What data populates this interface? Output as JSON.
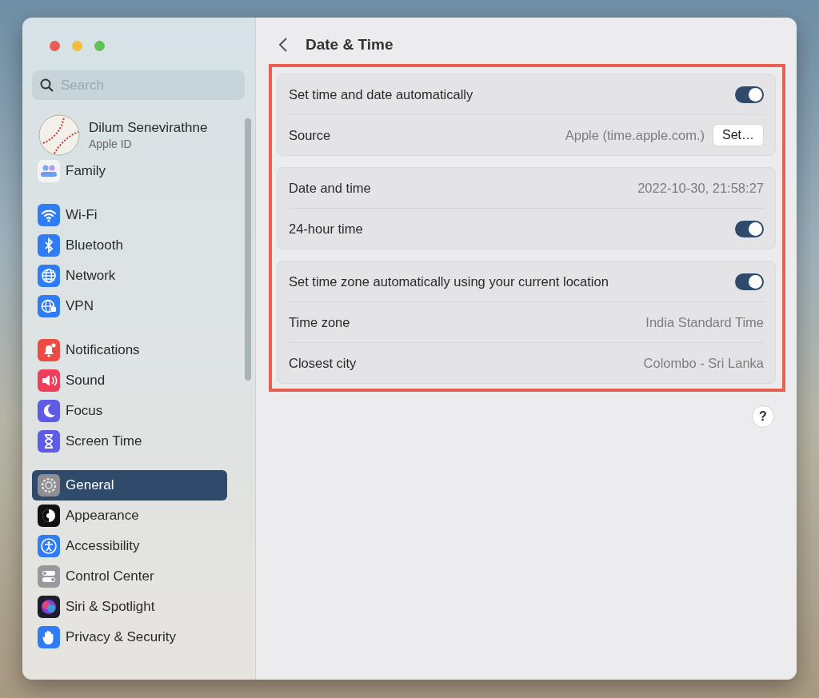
{
  "sidebar": {
    "search": {
      "placeholder": "Search"
    },
    "profile": {
      "name": "Dilum Senevirathne",
      "subtitle": "Apple ID"
    },
    "groups": [
      {
        "items": [
          {
            "label": "Family",
            "kind": "family",
            "selected": false
          }
        ]
      },
      {
        "items": [
          {
            "label": "Wi-Fi",
            "kind": "wifi",
            "selected": false
          },
          {
            "label": "Bluetooth",
            "kind": "bluetooth",
            "selected": false
          },
          {
            "label": "Network",
            "kind": "network",
            "selected": false
          },
          {
            "label": "VPN",
            "kind": "vpn",
            "selected": false
          }
        ]
      },
      {
        "items": [
          {
            "label": "Notifications",
            "kind": "notifications",
            "selected": false
          },
          {
            "label": "Sound",
            "kind": "sound",
            "selected": false
          },
          {
            "label": "Focus",
            "kind": "focus",
            "selected": false
          },
          {
            "label": "Screen Time",
            "kind": "screentime",
            "selected": false
          }
        ]
      },
      {
        "items": [
          {
            "label": "General",
            "kind": "general",
            "selected": true
          },
          {
            "label": "Appearance",
            "kind": "appearance",
            "selected": false
          },
          {
            "label": "Accessibility",
            "kind": "accessibility",
            "selected": false
          },
          {
            "label": "Control Center",
            "kind": "controlcenter",
            "selected": false
          },
          {
            "label": "Siri & Spotlight",
            "kind": "siri",
            "selected": false
          },
          {
            "label": "Privacy & Security",
            "kind": "privacy",
            "selected": false
          }
        ]
      }
    ]
  },
  "content": {
    "title": "Date & Time",
    "highlighted": true,
    "groups": [
      {
        "rows": [
          {
            "kind": "toggle",
            "label": "Set time and date automatically",
            "on": true
          },
          {
            "kind": "button",
            "label": "Source",
            "value": "Apple (time.apple.com.)",
            "button": "Set…"
          }
        ]
      },
      {
        "rows": [
          {
            "kind": "value",
            "label": "Date and time",
            "value": "2022-10-30, 21:58:27"
          },
          {
            "kind": "toggle",
            "label": "24-hour time",
            "on": true
          }
        ]
      },
      {
        "rows": [
          {
            "kind": "toggle",
            "label": "Set time zone automatically using your current location",
            "on": true
          },
          {
            "kind": "value",
            "label": "Time zone",
            "value": "India Standard Time"
          },
          {
            "kind": "value",
            "label": "Closest city",
            "value": "Colombo - Sri Lanka"
          }
        ]
      }
    ],
    "help": "?"
  }
}
